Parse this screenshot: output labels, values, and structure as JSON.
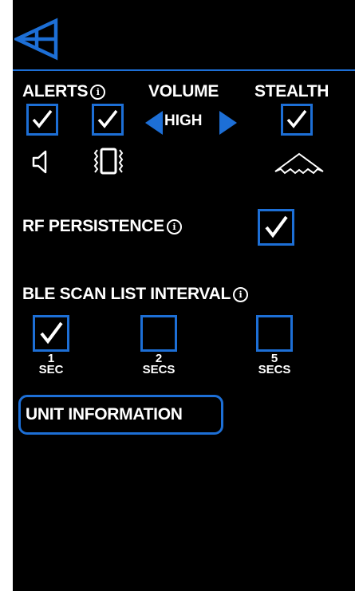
{
  "colors": {
    "accent": "#1d6fd6",
    "background": "#000000",
    "text": "#ffffff"
  },
  "header": {
    "back_icon": "back-arrow-icon"
  },
  "alerts": {
    "label": "ALERTS",
    "info_glyph": "i",
    "sound": {
      "checked": true,
      "icon": "speaker-icon"
    },
    "vibrate": {
      "checked": true,
      "icon": "vibrate-phone-icon"
    }
  },
  "volume": {
    "label": "VOLUME",
    "value": "HIGH"
  },
  "stealth": {
    "label": "STEALTH",
    "checked": true,
    "icon": "stealth-aircraft-icon"
  },
  "rf_persistence": {
    "label": "RF PERSISTENCE",
    "info_glyph": "i",
    "checked": true
  },
  "ble_scan": {
    "label": "BLE SCAN LIST INTERVAL",
    "info_glyph": "i",
    "options": [
      {
        "num": "1",
        "unit": "SEC",
        "checked": true
      },
      {
        "num": "2",
        "unit": "SECS",
        "checked": false
      },
      {
        "num": "5",
        "unit": "SECS",
        "checked": false
      }
    ]
  },
  "unit_info": {
    "label": "UNIT INFORMATION"
  }
}
